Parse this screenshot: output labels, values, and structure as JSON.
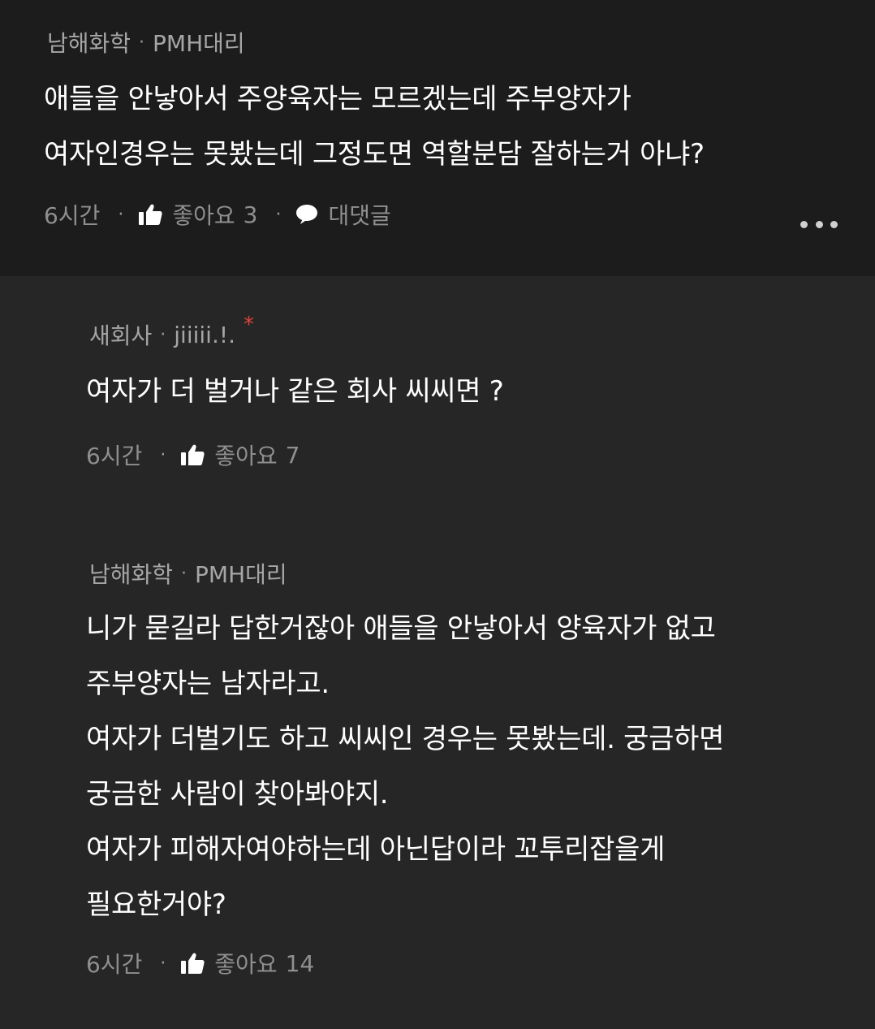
{
  "comments": [
    {
      "company": "남해화학",
      "nickname": "PMH대리",
      "text": "애들을 안낳아서 주양육자는 모르겠는데 주부양자가\n여자인경우는 못봤는데 그정도면 역할분담 잘하는거 아냐?",
      "time": "6시간",
      "like_label": "좋아요",
      "like_count": "3",
      "reply_label": "대댓글"
    },
    {
      "company": "새회사",
      "nickname": "jiiiii.!.",
      "author_mark": "*",
      "text": "여자가 더 벌거나 같은  회사 씨씨면 ?",
      "time": "6시간",
      "like_label": "좋아요",
      "like_count": "7"
    },
    {
      "company": "남해화학",
      "nickname": "PMH대리",
      "text": "니가 묻길라 답한거잖아 애들을 안낳아서 양육자가 없고\n주부양자는 남자라고.\n여자가 더벌기도 하고 씨씨인 경우는 못봤는데. 궁금하면\n궁금한 사람이 찾아봐야지.\n여자가 피해자여야하는데 아닌답이라 꼬투리잡을게\n필요한거야?",
      "time": "6시간",
      "like_label": "좋아요",
      "like_count": "14"
    }
  ],
  "icons": {
    "thumb": "thumbs-up-icon",
    "reply": "speech-bubble-icon",
    "more": "more-dots-icon"
  },
  "colors": {
    "top_background": "#1c1c1c",
    "reply_background": "#262626",
    "author_mark": "#e0443a"
  }
}
